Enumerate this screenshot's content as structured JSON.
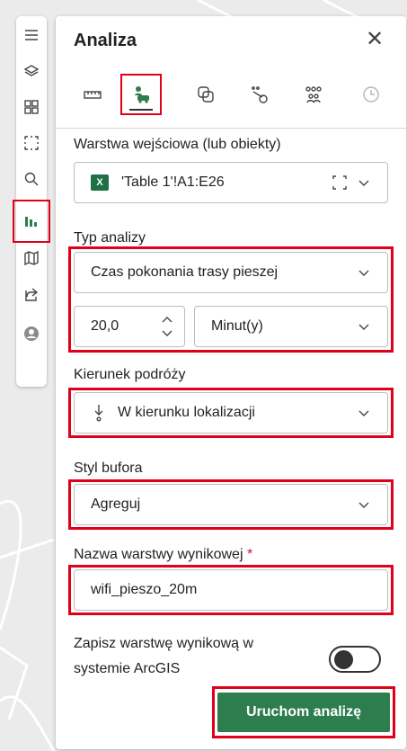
{
  "panel": {
    "title": "Analiza",
    "tools": [
      {
        "icon": "ruler-icon",
        "active": false
      },
      {
        "icon": "person-car-icon",
        "active": true
      },
      {
        "icon": "overlay-icon",
        "active": false
      },
      {
        "icon": "route-stops-icon",
        "active": false
      },
      {
        "icon": "people-group-icon",
        "active": false
      },
      {
        "icon": "clock-icon",
        "active": false
      }
    ],
    "input_layer": {
      "label": "Warstwa wejściowa (lub obiekty)",
      "value": "'Table 1'!A1:E26"
    },
    "analysis_type": {
      "label": "Typ analizy",
      "value": "Czas pokonania trasy pieszej",
      "amount": "20,0",
      "unit": "Minut(y)"
    },
    "direction": {
      "label": "Kierunek podróży",
      "value": "W kierunku lokalizacji"
    },
    "buffer_style": {
      "label": "Styl bufora",
      "value": "Agreguj"
    },
    "output_name": {
      "label": "Nazwa warstwy wynikowej",
      "required_mark": "*",
      "value": "wifi_pieszo_20m"
    },
    "save_arcgis": {
      "label_line1": "Zapisz warstwę wynikową w",
      "label_line2": "systemie ArcGIS",
      "enabled": false
    },
    "run_button": "Uruchom analizę"
  },
  "rail": [
    "menu-icon",
    "layers-icon",
    "qr-grid-icon",
    "select-box-icon",
    "search-icon",
    "analysis-icon",
    "map-icon",
    "share-icon",
    "user-avatar-icon"
  ],
  "colors": {
    "highlight": "#e0001b",
    "primary_button": "#2e7d4f",
    "excel": "#1e7145"
  }
}
